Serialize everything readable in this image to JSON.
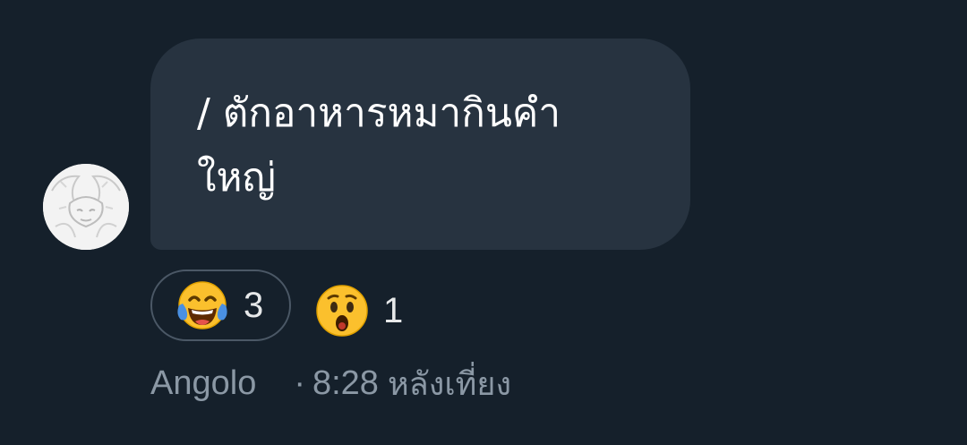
{
  "message": {
    "text": "/ ตักอาหารหมากินคำ\nใหญ่",
    "author": "Angolo",
    "separator": "·",
    "time": "8:28",
    "period": "หลังเที่ยง"
  },
  "reactions": [
    {
      "emoji": "face-with-tears-of-joy",
      "count": "3",
      "selected": true
    },
    {
      "emoji": "astonished-face",
      "count": "1",
      "selected": false
    }
  ],
  "colors": {
    "background": "#15202b",
    "bubble": "#273340",
    "muted_text": "#8b98a5",
    "pill_border": "#4b5866"
  }
}
